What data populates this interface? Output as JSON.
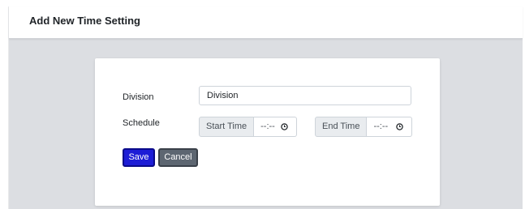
{
  "header": {
    "title": "Add New Time Setting"
  },
  "form": {
    "division": {
      "label": "Division",
      "value": "Division"
    },
    "schedule": {
      "label": "Schedule",
      "start": {
        "addon": "Start Time",
        "value": "--:--"
      },
      "end": {
        "addon": "End Time",
        "value": "--:--"
      }
    },
    "buttons": {
      "save": "Save",
      "cancel": "Cancel"
    }
  },
  "colors": {
    "save_button": "#1d1dd6",
    "cancel_button": "#5d6671",
    "background": "#dcdee2"
  },
  "icons": {
    "time_picker": "clock-icon"
  }
}
